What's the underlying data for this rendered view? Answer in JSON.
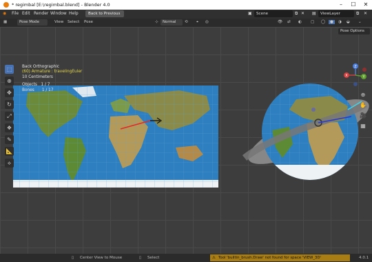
{
  "window": {
    "title": "* regimbal [E:\\regimbal.blend] - Blender 4.0"
  },
  "menu": {
    "items": [
      "File",
      "Edit",
      "Render",
      "Window",
      "Help"
    ],
    "back_label": "Back to Previous",
    "scene": "Scene",
    "view_layer": "ViewLayer"
  },
  "header": {
    "mode": "Pose Mode",
    "view": "View",
    "select": "Select",
    "pose": "Pose",
    "orientation": "Normal",
    "pose_options": "Pose Options"
  },
  "overlay": {
    "view_name": "Back Orthographic",
    "active": "(60) Armature : travelingEuler",
    "scale": "10 Centimeters",
    "objects_label": "Objects",
    "objects_value": "1 / 7",
    "bones_label": "Bones",
    "bones_value": "1 / 17"
  },
  "gizmo": {
    "x": "X",
    "y": "Y",
    "z": "Z"
  },
  "status": {
    "center_view": "Center View to Mouse",
    "select": "Select",
    "warning": "Tool 'builtin_brush.Draw' not found for space 'VIEW_3D'",
    "version": "4.0.1"
  },
  "colors": {
    "accent": "#4772b3",
    "ocean": "#2e7fbf",
    "land": "#6b8a3a",
    "warning": "#a87d14"
  }
}
